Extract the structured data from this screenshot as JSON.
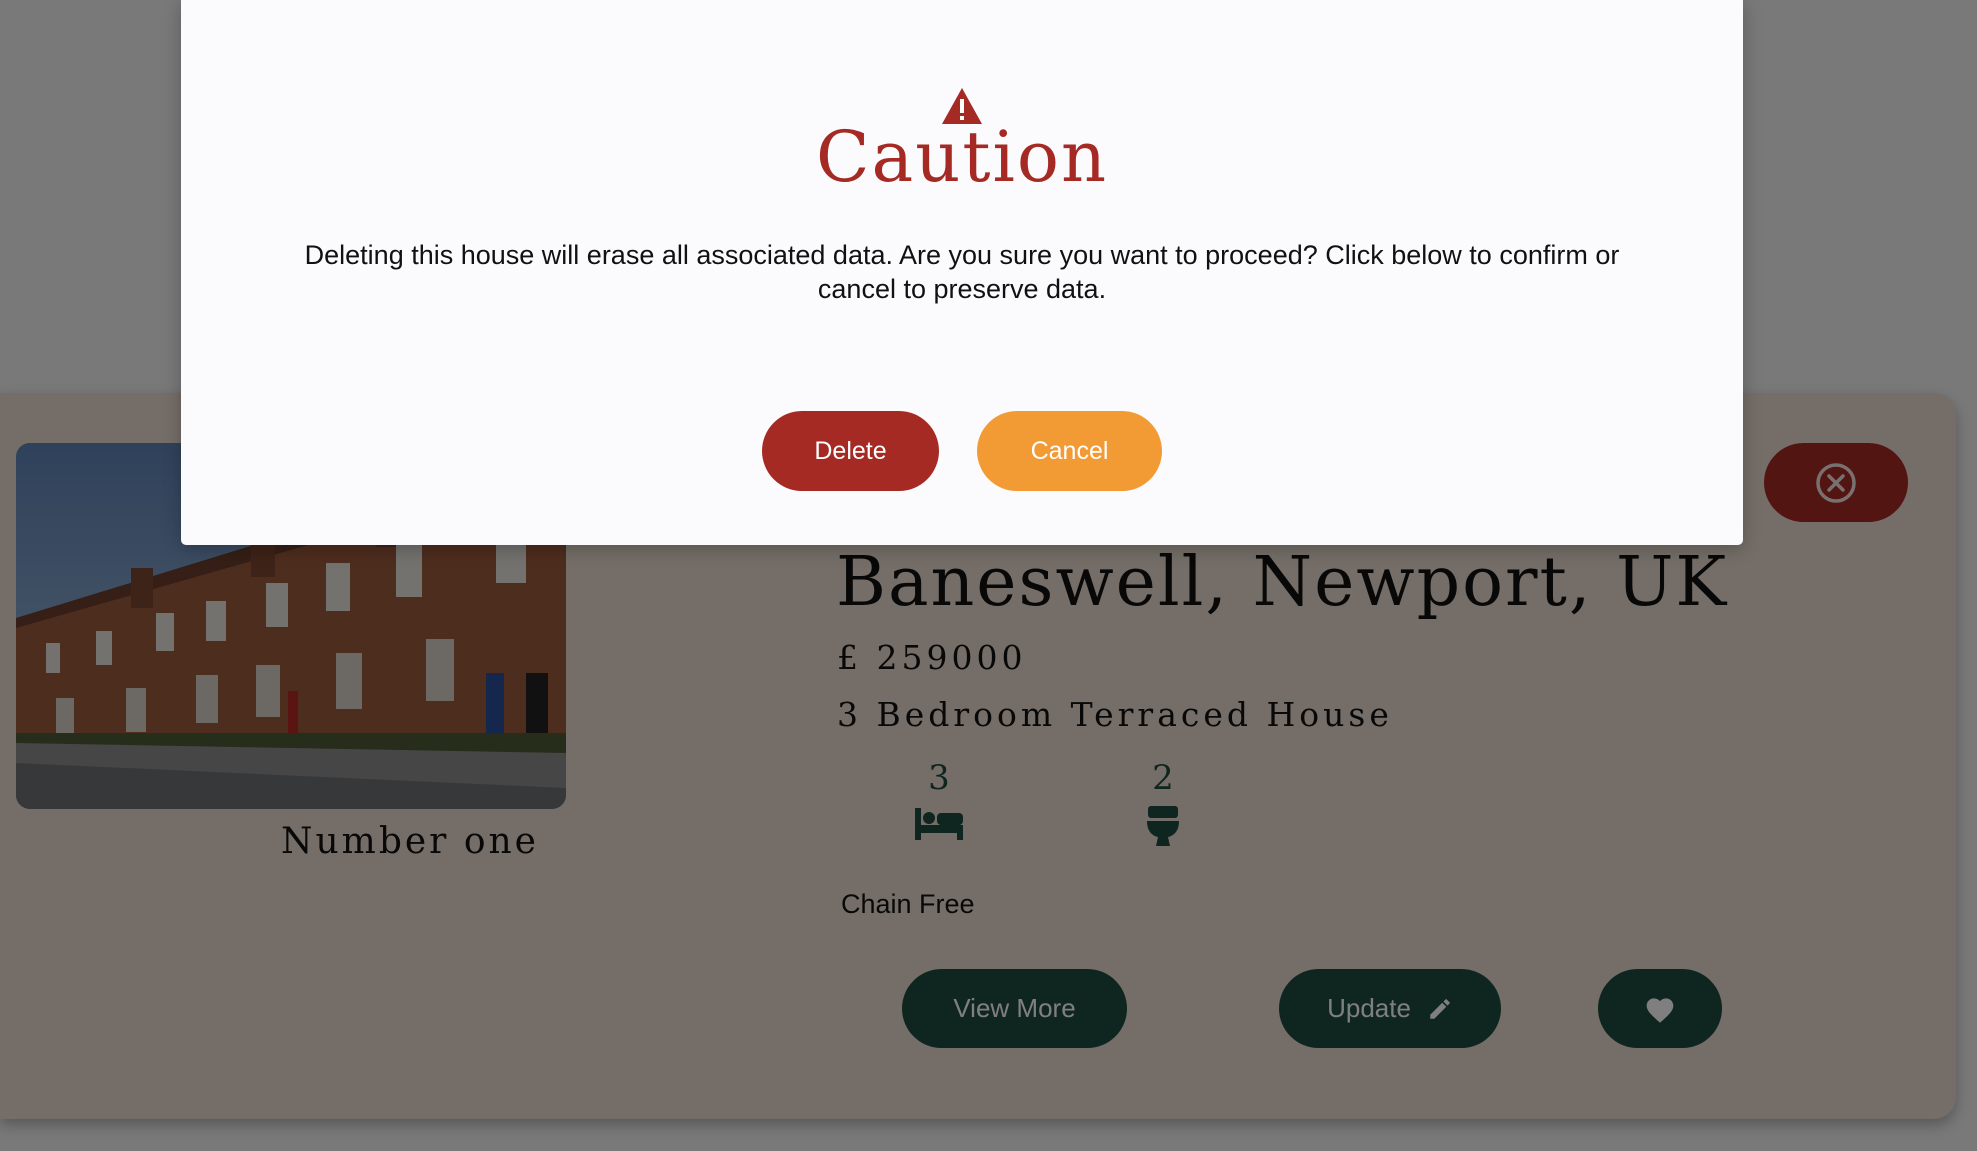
{
  "colors": {
    "danger": "#a52a24",
    "warning": "#f29a33",
    "primary": "#1f4a40",
    "card_bg": "#ebddd0",
    "modal_bg": "#fbfafc"
  },
  "listing": {
    "name": "Number one",
    "location": "Baneswell, Newport, UK",
    "price": "£ 259000",
    "type": "3 Bedroom Terraced House",
    "bedrooms": "3",
    "bathrooms": "2",
    "chain_status": "Chain Free",
    "icons": {
      "photo": "terraced-house-photo",
      "close": "close-circle-icon",
      "bed": "bed-icon",
      "toilet": "toilet-icon",
      "edit": "pencil-icon",
      "favourite": "heart-icon"
    },
    "buttons": {
      "view_more": "View More",
      "update": "Update"
    }
  },
  "modal": {
    "icon": "warning-icon",
    "title": "Caution",
    "message": "Deleting this house will erase all associated data. Are you sure you want to proceed? Click below to confirm or cancel to preserve data.",
    "delete_label": "Delete",
    "cancel_label": "Cancel"
  }
}
